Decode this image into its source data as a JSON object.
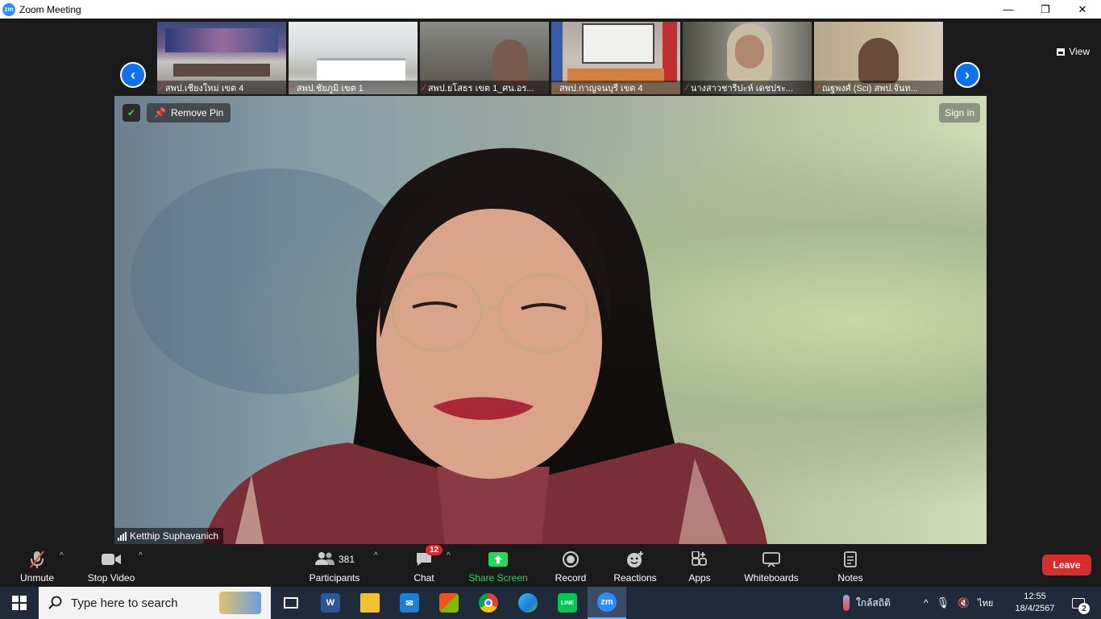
{
  "window": {
    "title": "Zoom Meeting",
    "minimize": "—",
    "restore": "❐",
    "close": "✕"
  },
  "thumbnails": [
    {
      "label": "สพป.เชียงใหม่ เขต 4"
    },
    {
      "label": "สพป.ชัยภูมิ เขต 1"
    },
    {
      "label": "สพป.ยโสธร เขต 1_ศน.อร..."
    },
    {
      "label": "สพป.กาญจนบุรี เขต 4"
    },
    {
      "label": "นางสาวชารีปะห์ เดชประ..."
    },
    {
      "label": "ณฐพงศ์ (Sci) สพป.จันท..."
    }
  ],
  "view_button": {
    "label": "View"
  },
  "main_video": {
    "remove_pin": "Remove Pin",
    "sign_in": "Sign in",
    "speaker_name": "Ketthip Suphavanich"
  },
  "toolbar": {
    "unmute": "Unmute",
    "stop_video": "Stop Video",
    "participants": "Participants",
    "participants_count": "381",
    "chat": "Chat",
    "chat_badge": "12",
    "share_screen": "Share Screen",
    "record": "Record",
    "reactions": "Reactions",
    "apps": "Apps",
    "whiteboards": "Whiteboards",
    "notes": "Notes",
    "leave": "Leave"
  },
  "taskbar": {
    "search_placeholder": "Type here to search",
    "weather": "ใกล้สถิติ",
    "language": "ไทย",
    "time": "12:55",
    "date": "18/4/2567",
    "notification_count": "2",
    "apps": [
      {
        "name": "task-view",
        "text": ""
      },
      {
        "name": "word",
        "text": "W"
      },
      {
        "name": "file-explorer",
        "text": ""
      },
      {
        "name": "mail",
        "text": ""
      },
      {
        "name": "store",
        "text": ""
      },
      {
        "name": "chrome",
        "text": ""
      },
      {
        "name": "edge",
        "text": ""
      },
      {
        "name": "line",
        "text": "LINE"
      },
      {
        "name": "zoom",
        "text": "zm"
      }
    ]
  },
  "colors": {
    "zoom_blue": "#0e72ed",
    "share_green": "#23d959",
    "leave_red": "#d92d2d",
    "badge_red": "#e02828",
    "muted_red": "#e8453c"
  }
}
